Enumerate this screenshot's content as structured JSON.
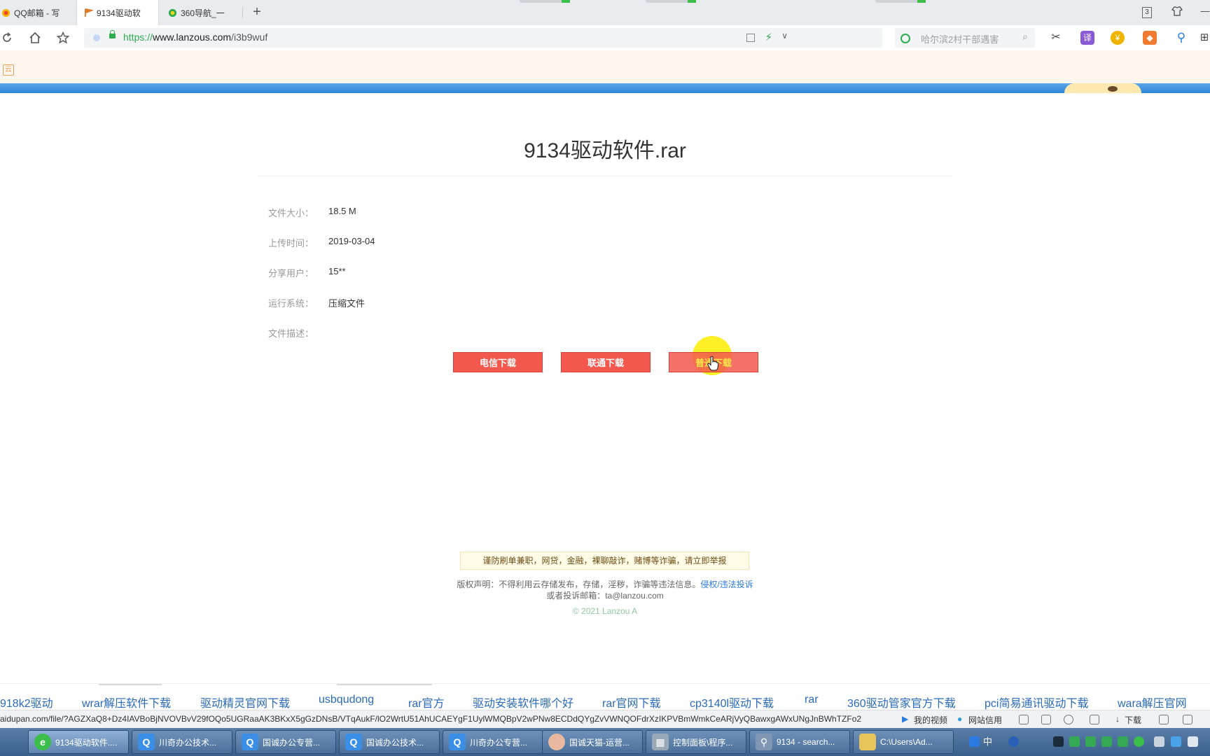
{
  "browser": {
    "tabs": [
      {
        "label": "QQ邮箱 - 写",
        "active": false
      },
      {
        "label": "9134驱动软",
        "active": true
      },
      {
        "label": "360导航_一",
        "active": false
      }
    ],
    "new_tab_label": "+",
    "window_badge": "3",
    "url_protocol": "https://",
    "url_host": "www.lanzous.com",
    "url_path": "/i3b9wuf",
    "search_placeholder": "哈尔滨2村干部遇害",
    "translate_label": "译"
  },
  "page": {
    "file_title": "9134驱动软件.rar",
    "info": [
      {
        "label": "文件大小：",
        "value": "18.5 M"
      },
      {
        "label": "上传时间：",
        "value": "2019-03-04"
      },
      {
        "label": "分享用户：",
        "value": "15**"
      },
      {
        "label": "运行系统：",
        "value": "压缩文件"
      },
      {
        "label": "文件描述：",
        "value": ""
      }
    ],
    "buttons": {
      "telecom": "电信下载",
      "unicom": "联通下载",
      "normal": "普通下载"
    },
    "warning": "谨防刷单兼职，网贷，金融，裸聊敲诈，赌博等诈骗，请立即举报",
    "copyright_text": "版权声明：不得利用云存储发布，存储，淫秽，诈骗等违法信息。",
    "copyright_link": "侵权/违法投诉",
    "report_email": "或者投诉邮箱：ta@lanzou.com",
    "copyright_year": "© 2021 Lanzou A"
  },
  "related_searches": [
    "918k2驱动",
    "wrar解压软件下载",
    "驱动精灵官网下载",
    "usbqudong",
    "rar官方",
    "驱动安装软件哪个好",
    "rar官网下载",
    "cp3140l驱动下载",
    "rar",
    "360驱动管家官方下载",
    "pci简易通讯驱动下载",
    "wara解压官网"
  ],
  "status_bar": {
    "url": "aidupan.com/file/?AGZXaQ8+Dz4IAVBoBjNVOVBvV29fOQo5UGRaaAK3BKxX5gGzDNsB/VTqAukF/lO2WrtU51AhUCAEYgF1UylWMQBpV2wPNw8ECDdQYgZvVWNQOFdrXzIKPVBmWmkCeARjVyQBawxgAWxUNgJnBWhTZFo2",
    "my_video": "我的视频",
    "site_credit": "网站信用",
    "download": "下载"
  },
  "taskbar": [
    {
      "label": "9134驱动软件....",
      "icon": "browser-360-icon",
      "color": "#3bbf4a"
    },
    {
      "label": "川奇办公技术...",
      "icon": "chat-app-icon",
      "color": "#3a8ee6"
    },
    {
      "label": "国诚办公专营...",
      "icon": "chat-app-icon",
      "color": "#3a8ee6"
    },
    {
      "label": "国诚办公技术...",
      "icon": "chat-app-icon",
      "color": "#3a8ee6"
    },
    {
      "label": "川奇办公专营...",
      "icon": "chat-app-icon",
      "color": "#3a8ee6"
    },
    {
      "label": "国诚天猫-运营...",
      "icon": "avatar-icon",
      "color": "#e8b9a0"
    },
    {
      "label": "控制面板\\程序...",
      "icon": "control-panel-icon",
      "color": "#9aa9b8"
    },
    {
      "label": "9134 - search...",
      "icon": "search-icon",
      "color": "#7f97b3"
    },
    {
      "label": "C:\\Users\\Ad...",
      "icon": "folder-icon",
      "color": "#e8c35a"
    }
  ],
  "tray": {
    "ime_label": "中"
  }
}
